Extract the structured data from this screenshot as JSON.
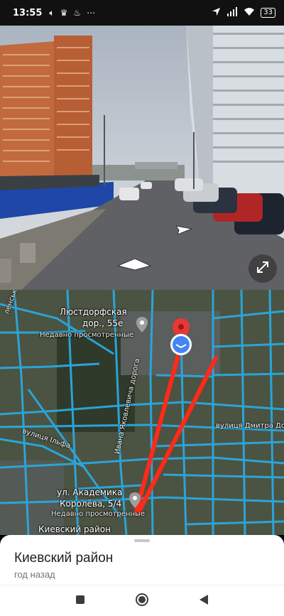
{
  "status_bar": {
    "time": "13:55",
    "battery": "33"
  },
  "map": {
    "labels": {
      "poi1_name": "Люстдорфская",
      "poi1_name2": "дор., 55е",
      "poi1_sub": "Недавно просмотренные",
      "poi2_name": "ул. Академика",
      "poi2_name2": "Королёва, 5/4",
      "poi2_sub": "Недавно просмотренные",
      "poi3_name": "Киевский район",
      "street_dmitra": "вулиця Дмитра Доно",
      "street_ilf": "вулиця Ільфа",
      "street_road": "Ивана Яковлевича дорога",
      "street_left": "ленська"
    },
    "colors": {
      "road": "#2aa9e0",
      "route": "#ff2a1a",
      "pin": "#e53935",
      "location_dot": "#4285f4"
    }
  },
  "sheet": {
    "title": "Киевский район",
    "subtitle": "год назад"
  },
  "icons": {
    "expand": "expand-icon",
    "pin": "map-pin-icon",
    "location": "location-dot-icon",
    "nav_back": "back-icon",
    "nav_home": "home-icon",
    "nav_recents": "recents-icon"
  }
}
